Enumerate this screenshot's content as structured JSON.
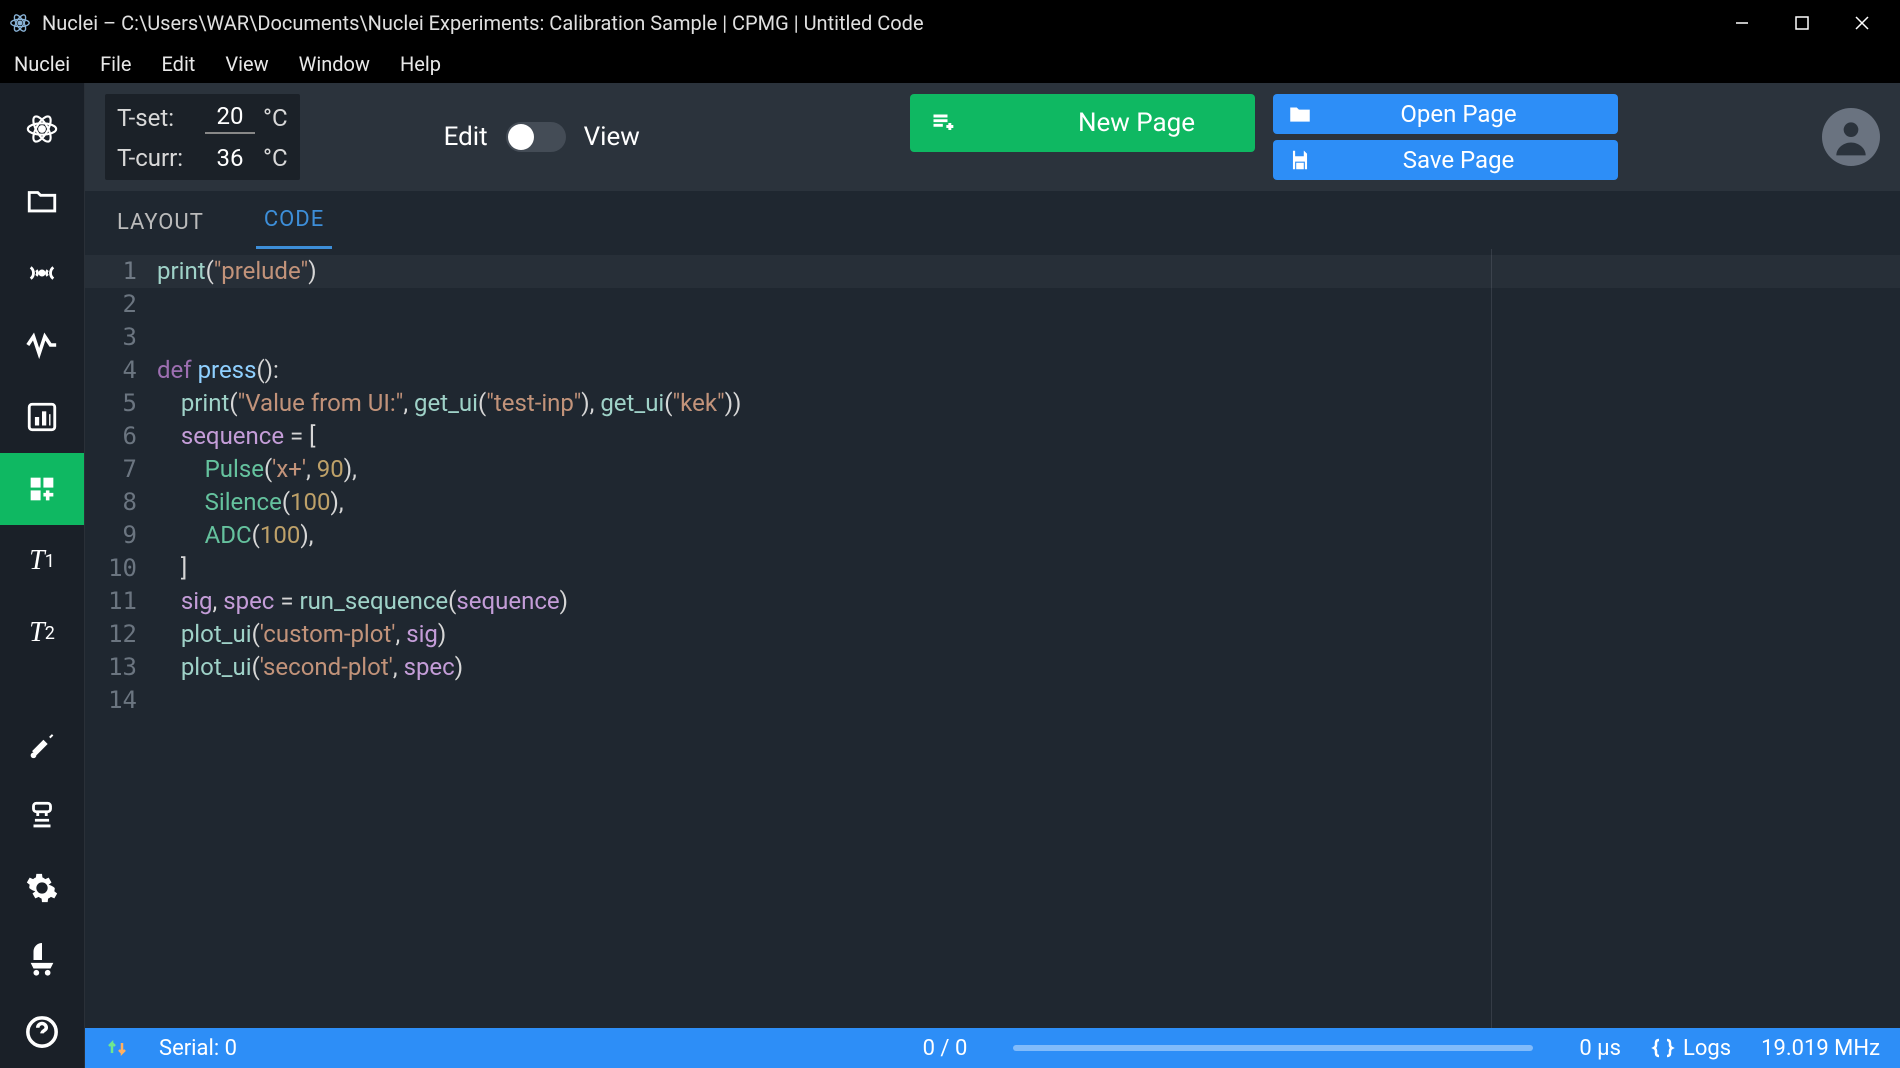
{
  "window": {
    "title": "Nuclei – C:\\Users\\WAR\\Documents\\Nuclei Experiments: Calibration Sample | CPMG | Untitled Code"
  },
  "menu": [
    "Nuclei",
    "File",
    "Edit",
    "View",
    "Window",
    "Help"
  ],
  "sidebar": [
    {
      "name": "atom-icon"
    },
    {
      "name": "folder-icon"
    },
    {
      "name": "signal-icon"
    },
    {
      "name": "wave-icon"
    },
    {
      "name": "chart-icon"
    },
    {
      "name": "page-plus-icon",
      "active": true
    },
    {
      "name": "t1"
    },
    {
      "name": "t2"
    },
    {
      "name": "dig-icon"
    },
    {
      "name": "scan-icon"
    },
    {
      "name": "gear-icon"
    },
    {
      "name": "bug-icon"
    },
    {
      "name": "help-icon"
    }
  ],
  "topbar": {
    "t_set_label": "T-set:",
    "t_set_value": "20",
    "t_curr_label": "T-curr:",
    "t_curr_value": "36",
    "unit": "°C",
    "edit_label": "Edit",
    "view_label": "View",
    "new_page": "New Page",
    "open_page": "Open Page",
    "save_page": "Save Page"
  },
  "tabs": {
    "layout": "LAYOUT",
    "code": "CODE"
  },
  "code_lines": [
    "print(\"prelude\")",
    "",
    "",
    "def press():",
    "    print(\"Value from UI:\", get_ui(\"test-inp\"), get_ui(\"kek\"))",
    "    sequence = [",
    "        Pulse('x+', 90),",
    "        Silence(100),",
    "        ADC(100),",
    "    ]",
    "    sig, spec = run_sequence(sequence)",
    "    plot_ui('custom-plot', sig)",
    "    plot_ui('second-plot', spec)",
    ""
  ],
  "status": {
    "serial": "Serial: 0",
    "progress": "0 / 0",
    "time": "0 µs",
    "logs": "Logs",
    "freq": "19.019 MHz"
  }
}
